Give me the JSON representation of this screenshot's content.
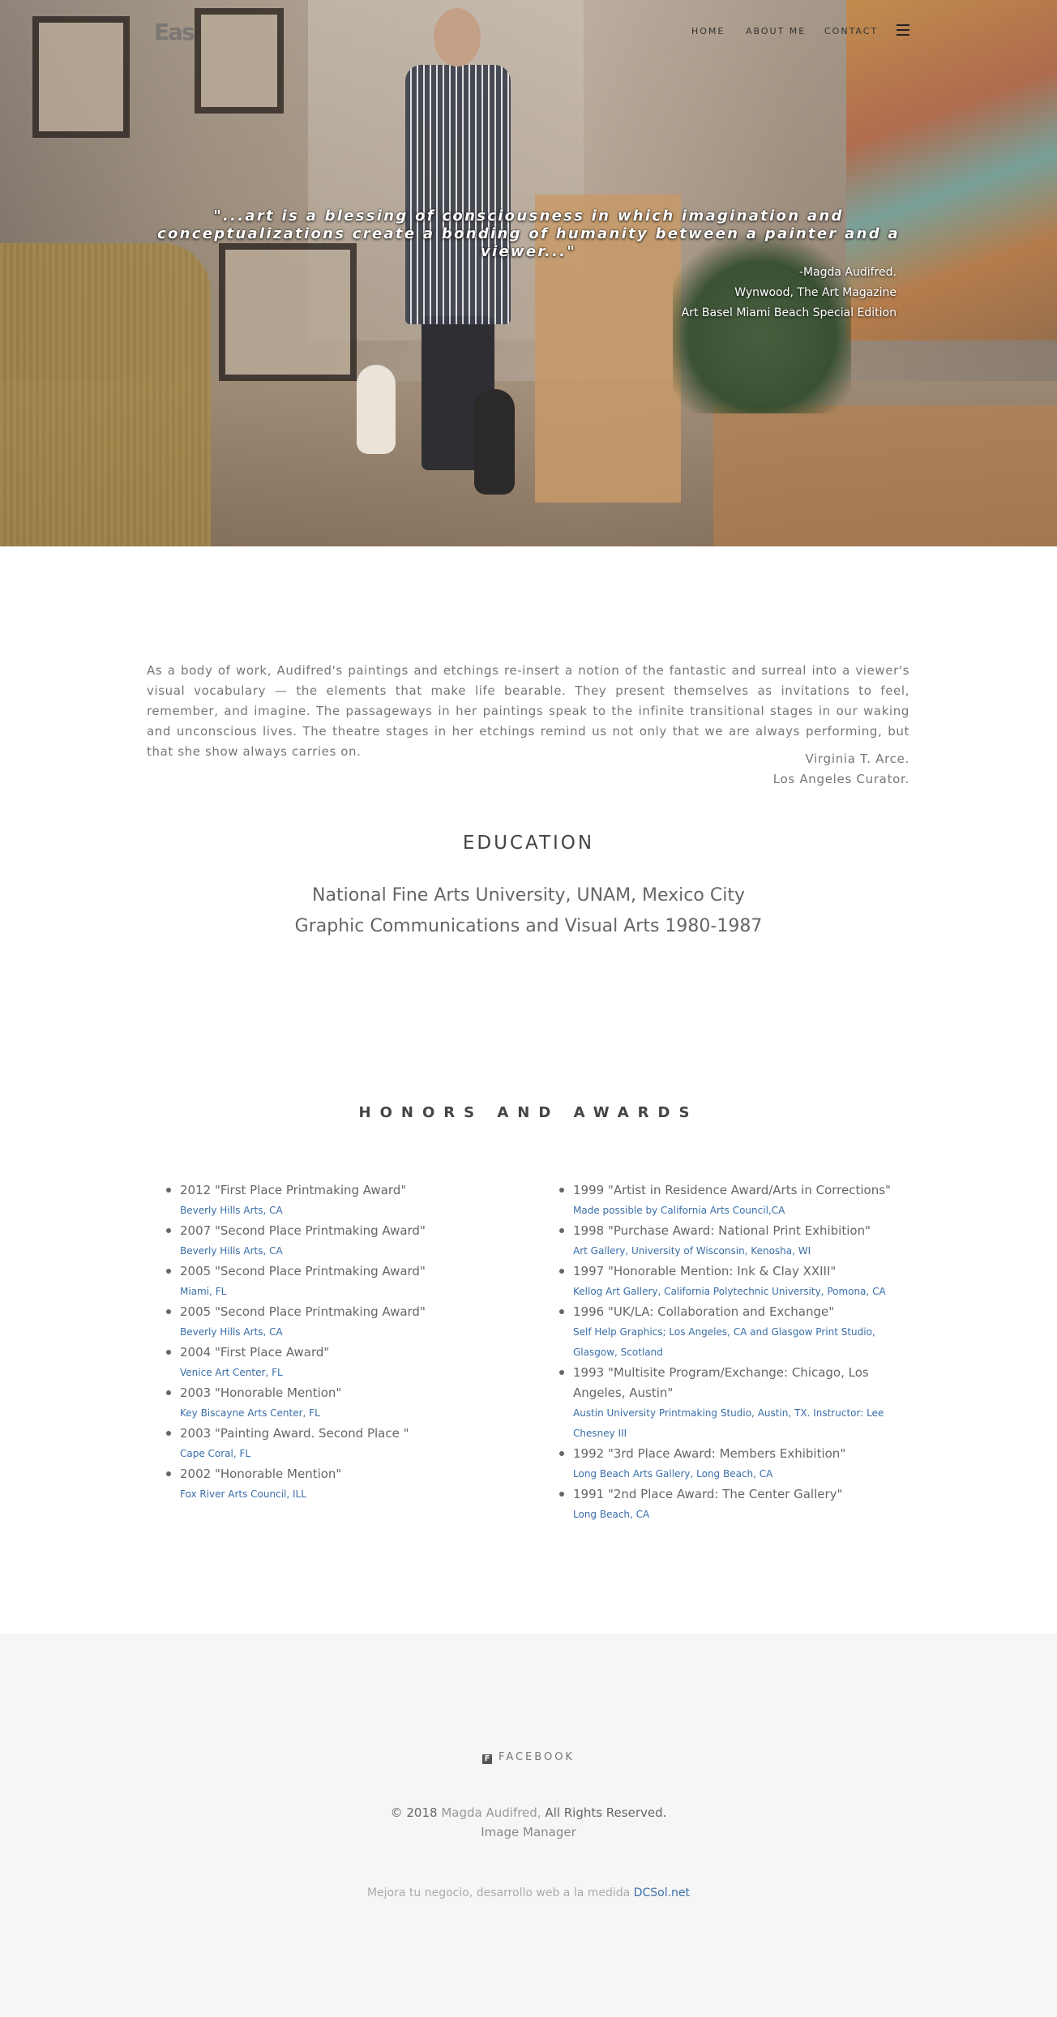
{
  "header": {
    "logo_text": "Eas",
    "nav": [
      "HOME",
      "ABOUT ME",
      "CONTACT"
    ]
  },
  "hero": {
    "quote": "\"...art is a blessing of consciousness in which imagination and conceptualizations create a bonding of humanity between a painter and a viewer...\"",
    "attribution": [
      "-Magda Audifred.",
      "Wynwood, The Art Magazine",
      "Art Basel Miami Beach Special Edition"
    ]
  },
  "intro": {
    "paragraph": "As a body of work, Audifred's paintings and etchings re-insert a notion of the fantastic and surreal into a viewer's visual vocabulary — the elements that make life bearable. They present themselves as invitations to feel, remember, and imagine. The passageways in her paintings speak to the infinite transitional stages in our waking and unconscious lives. The theatre stages in her etchings remind us not only that we are always performing, but that she show always carries on.",
    "curator_name": "Virginia T. Arce.",
    "curator_title": "Los Angeles Curator."
  },
  "education": {
    "title": "EDUCATION",
    "lines": [
      "National Fine Arts University, UNAM, Mexico City",
      "Graphic Communications and Visual Arts 1980-1987"
    ]
  },
  "honors": {
    "title": "HONORS AND AWARDS",
    "left": [
      {
        "title": "2012 \"First Place Printmaking Award\"",
        "place": "Beverly Hills Arts, CA"
      },
      {
        "title": "2007 \"Second Place Printmaking Award\"",
        "place": "Beverly Hills Arts, CA"
      },
      {
        "title": "2005 \"Second Place Printmaking Award\"",
        "place": "Miami, FL"
      },
      {
        "title": "2005 \"Second Place Printmaking Award\"",
        "place": "Beverly Hills Arts, CA"
      },
      {
        "title": "2004 \"First Place Award\"",
        "place": "Venice Art Center, FL"
      },
      {
        "title": "2003 \"Honorable Mention\"",
        "place": "Key Biscayne Arts Center, FL"
      },
      {
        "title": "2003 \"Painting Award. Second Place \"",
        "place": "Cape Coral, FL"
      },
      {
        "title": "2002 \"Honorable Mention\"",
        "place": "Fox River Arts Council, ILL"
      }
    ],
    "right": [
      {
        "title": "1999 \"Artist in Residence Award/Arts in Corrections\"",
        "place": "Made possible by California Arts Council,CA"
      },
      {
        "title": "1998 \"Purchase Award: National Print Exhibition\"",
        "place": "Art Gallery, University of Wisconsin, Kenosha, WI"
      },
      {
        "title": "1997 \"Honorable Mention: Ink & Clay XXIII\"",
        "place": "Kellog Art Gallery, California Polytechnic University, Pomona, CA"
      },
      {
        "title": "1996 \"UK/LA: Collaboration and Exchange\"",
        "place": "Self Help Graphics; Los Angeles, CA and Glasgow Print Studio, Glasgow, Scotland"
      },
      {
        "title": "1993 \"Multisite Program/Exchange: Chicago, Los Angeles, Austin\"",
        "place": "Austin University Printmaking Studio, Austin, TX. Instructor: Lee Chesney III"
      },
      {
        "title": "1992 \"3rd Place Award: Members Exhibition\"",
        "place": "Long Beach Arts Gallery, Long Beach, CA"
      },
      {
        "title": "1991 \"2nd Place Award: The Center Gallery\"",
        "place": "Long Beach, CA"
      }
    ]
  },
  "footer": {
    "facebook_label": "FACEBOOK",
    "copyright_prefix": "© 2018",
    "copyright_owner": "Magda Audifred,",
    "copyright_suffix": "All Rights Reserved.",
    "image_manager": "Image Manager",
    "credit_text": "Mejora tu negocio, desarrollo web a la medida",
    "credit_link": "DCSol.net"
  },
  "colors": {
    "link": "#3a6ea8",
    "footer_bg": "#f6f6f6"
  }
}
